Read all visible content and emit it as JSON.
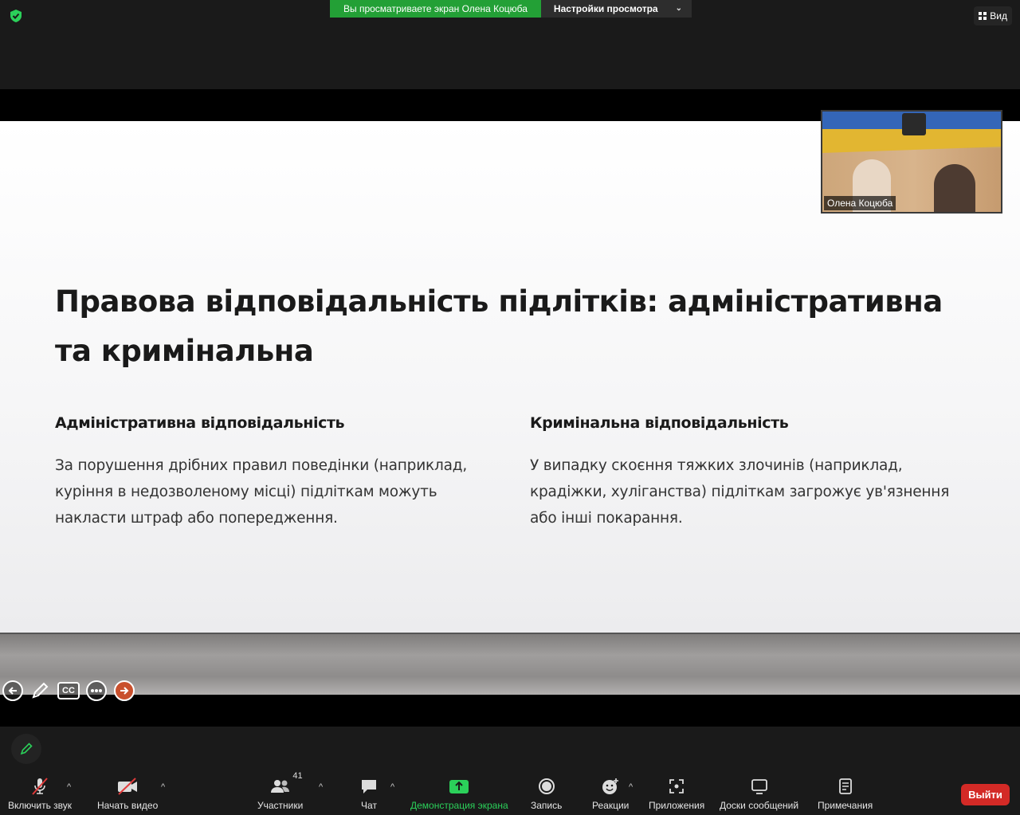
{
  "top": {
    "banner_text": "Вы просматриваете экран Олена Коцюба",
    "view_settings_label": "Настройки просмотра",
    "view_label": "Вид"
  },
  "slide": {
    "title": "Правова відповідальність підлітків: адміністративна та кримінальна",
    "left_heading": "Адміністративна відповідальність",
    "left_text": "За порушення дрібних правил поведінки (наприклад, куріння в недозволеному місці) підліткам можуть накласти штраф або попередження.",
    "right_heading": "Кримінальна відповідальність",
    "right_text": "У випадку скоєння тяжких злочинів (наприклад, крадіжки, хуліганства) підліткам загрожує ув'язнення або інші покарання.",
    "cc_label": "CC"
  },
  "video": {
    "participant_name": "Олена Коцюба"
  },
  "toolbar": {
    "audio_label": "Включить звук",
    "video_label": "Начать видео",
    "participants_label": "Участники",
    "participants_count": "41",
    "chat_label": "Чат",
    "share_label": "Демонстрация экрана",
    "record_label": "Запись",
    "reactions_label": "Реакции",
    "apps_label": "Приложения",
    "whiteboards_label": "Доски сообщений",
    "notes_label": "Примечания",
    "leave_label": "Выйти"
  },
  "colors": {
    "accent_green": "#23a036",
    "leave_red": "#d32a26",
    "background": "#1a1a1a"
  }
}
